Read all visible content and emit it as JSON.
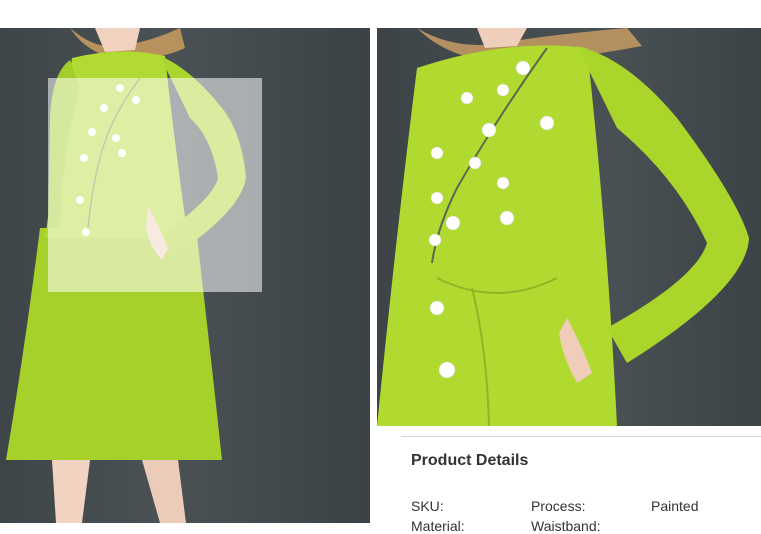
{
  "images": {
    "main_alt": "",
    "zoom_alt": ""
  },
  "details": {
    "title": "Product Details",
    "specs": [
      {
        "label": "SKU:",
        "value": ""
      },
      {
        "label": "Process:",
        "value": "Painted"
      }
    ],
    "partial_row": [
      "Material:",
      "Waistband:"
    ]
  },
  "colors": {
    "dress": "#a9d62c",
    "background": "#444c4f",
    "flower": "#ffffff"
  }
}
